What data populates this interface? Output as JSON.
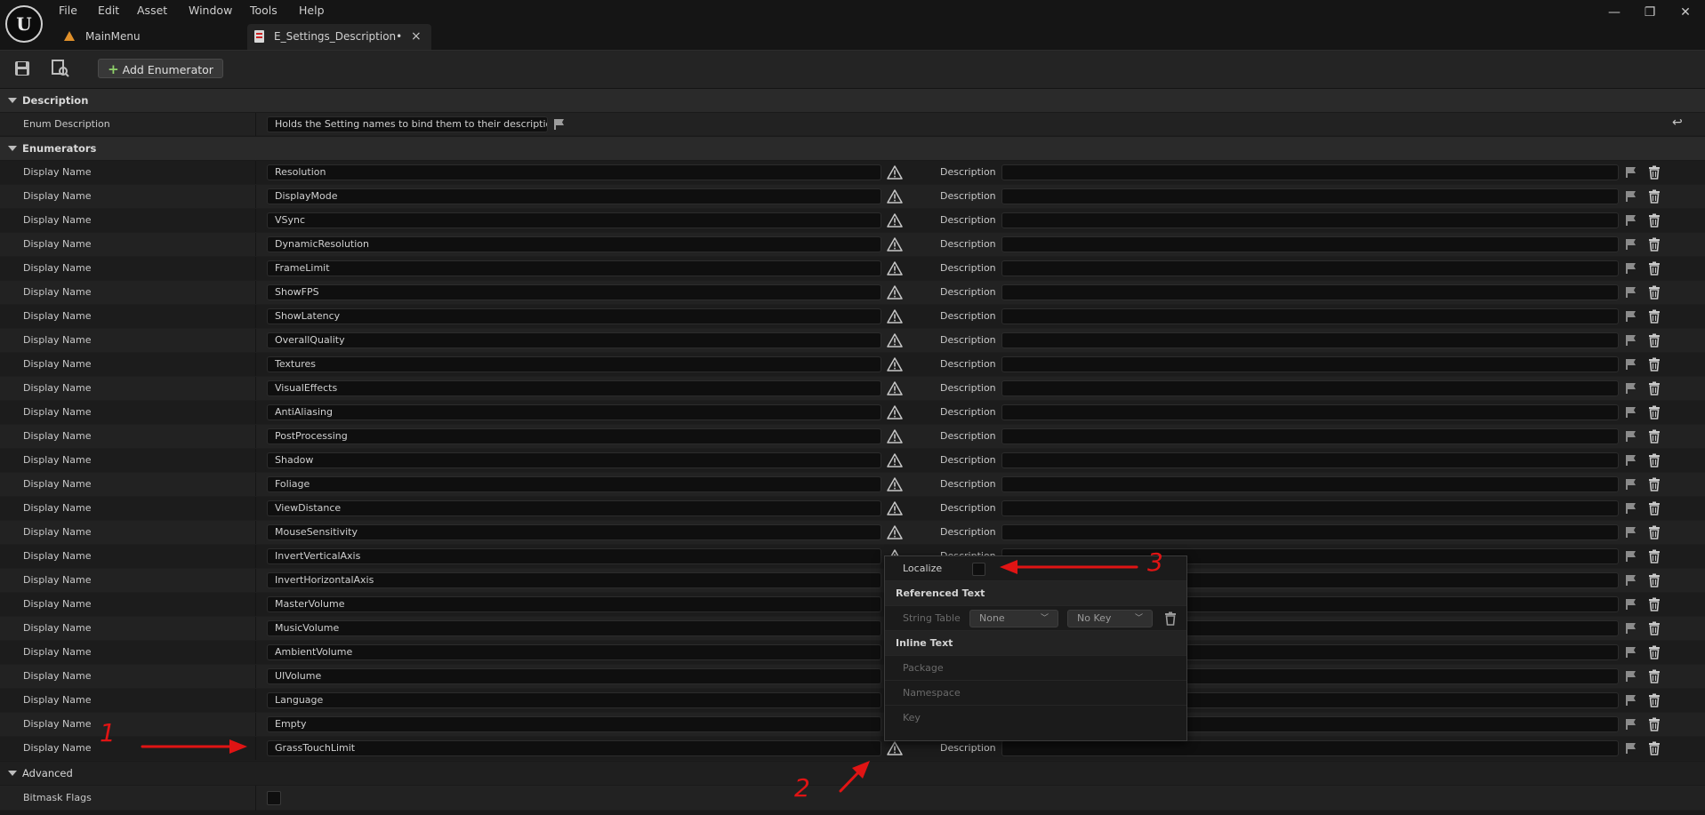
{
  "menu": [
    "File",
    "Edit",
    "Asset",
    "Window",
    "Tools",
    "Help"
  ],
  "window_controls": {
    "minimize": "—",
    "restore": "❐",
    "close": "✕"
  },
  "tabs": [
    {
      "label": "MainMenu"
    },
    {
      "label": "E_Settings_Description•",
      "close": "×"
    }
  ],
  "toolbar": {
    "add_enumerator_label": "Add Enumerator",
    "add_plus": "+"
  },
  "description_section": {
    "title": "Description",
    "enum_description_label": "Enum Description",
    "enum_description_value": "Holds the Setting names to bind them to their descriptions."
  },
  "enumerators_section": {
    "title": "Enumerators",
    "row_label": "Display Name",
    "description_label": "Description",
    "items": [
      "Resolution",
      "DisplayMode",
      "VSync",
      "DynamicResolution",
      "FrameLimit",
      "ShowFPS",
      "ShowLatency",
      "OverallQuality",
      "Textures",
      "VisualEffects",
      "AntiAliasing",
      "PostProcessing",
      "Shadow",
      "Foliage",
      "ViewDistance",
      "MouseSensitivity",
      "InvertVerticalAxis",
      "InvertHorizontalAxis",
      "MasterVolume",
      "MusicVolume",
      "AmbientVolume",
      "UIVolume",
      "Language",
      "Empty",
      "GrassTouchLimit"
    ]
  },
  "advanced_section": {
    "title": "Advanced",
    "bitmask_label": "Bitmask Flags"
  },
  "localize_popup": {
    "localize_label": "Localize",
    "referenced_text_header": "Referenced Text",
    "string_table_label": "String Table",
    "string_table_value": "None",
    "key_value": "No Key",
    "inline_text_header": "Inline Text",
    "package_label": "Package",
    "namespace_label": "Namespace",
    "key_label": "Key"
  },
  "annotations": {
    "one": "1",
    "two": "2",
    "three": "3"
  },
  "colors": {
    "annotation_red": "#e01414",
    "panel_bg": "#1a1a1a",
    "row_alt": "#222222"
  }
}
